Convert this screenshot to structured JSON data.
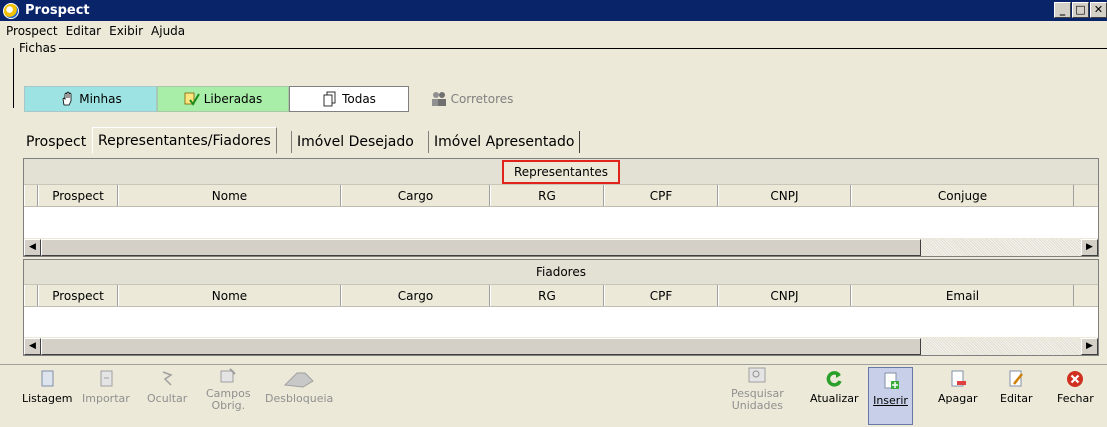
{
  "window": {
    "title": "Prospect"
  },
  "menu": [
    "Prospect",
    "Editar",
    "Exibir",
    "Ajuda"
  ],
  "fichas": {
    "label": "Fichas",
    "buttons": [
      "Minhas",
      "Liberadas",
      "Todas",
      "Corretores"
    ]
  },
  "tabs": [
    "Prospect",
    "Representantes/Fiadores",
    "Imóvel Desejado",
    "Imóvel Apresentado"
  ],
  "representantes": {
    "title": "Representantes",
    "columns": [
      "Prospect",
      "Nome",
      "Cargo",
      "RG",
      "CPF",
      "CNPJ",
      "Conjuge"
    ]
  },
  "fiadores": {
    "title": "Fiadores",
    "columns": [
      "Prospect",
      "Nome",
      "Cargo",
      "RG",
      "CPF",
      "CNPJ",
      "Email"
    ]
  },
  "toolbar": {
    "listagem": "Listagem",
    "importar": "Importar",
    "ocultar": "Ocultar",
    "campos_1": "Campos",
    "campos_2": "Obrig.",
    "desbloqueia": "Desbloqueia",
    "pesquisar_1": "Pesquisar",
    "pesquisar_2": "Unidades",
    "atualizar": "Atualizar",
    "inserir": "Inserir",
    "apagar": "Apagar",
    "editar": "Editar",
    "fechar": "Fechar"
  },
  "colors": {
    "titlebar": "#0a246a",
    "minhas": "#9ee3e3",
    "liberadas": "#a8eea8",
    "highlight": "#e0241c"
  }
}
